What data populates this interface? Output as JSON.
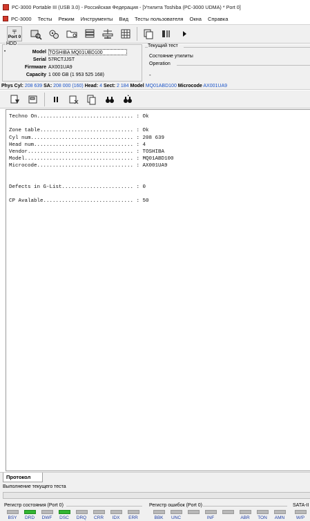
{
  "window": {
    "title": "PC-3000 Portable III (USB 3.0) - Российская Федерация - [Утилита Toshiba (PC-3000 UDMA) * Port 0]"
  },
  "menu": {
    "items": [
      "PC-3000",
      "Тесты",
      "Режим",
      "Инструменты",
      "Вид",
      "Тесты пользователя",
      "Окна",
      "Справка"
    ]
  },
  "toolbar1": {
    "port_label": "Port 0",
    "icons": [
      "port-icon",
      "drive-search-icon",
      "gears-icon",
      "folder-icon",
      "database-icon",
      "balance-icon",
      "grid-icon",
      "copy-icon",
      "log-icon",
      "play-icon"
    ]
  },
  "hdd": {
    "legend": "HDD",
    "rows": [
      {
        "key": "Model",
        "value": "TOSHIBA MQ01UBD100"
      },
      {
        "key": "Serial",
        "value": "57RCTJJST"
      },
      {
        "key": "Firmware",
        "value": "AX001UA9"
      },
      {
        "key": "Capacity",
        "value": "1 000 GB (1 953 525 168)"
      }
    ]
  },
  "current_test": {
    "legend": "Текущий тест",
    "value": "Состояние утилиты",
    "operation_legend": "Operation",
    "operation_value": "-"
  },
  "statusline": {
    "physcyl_label": "Phys Cyl:",
    "physcyl_value": "208 639",
    "sa_label": "SA:",
    "sa_value": "208 000 (160)",
    "head_label": "Head:",
    "head_value": "4",
    "sect_label": "Sect:",
    "sect_value": "2 184",
    "model_label": "Model",
    "model_value": "MQ01ABD100",
    "microcode_label": "Microcode",
    "microcode_value": "AX001UA9"
  },
  "log": {
    "lines": [
      "Techno On............................... : Ok",
      "",
      "Zone table.............................. : Ok",
      "Cyl num................................. : 208 639",
      "Head num................................ : 4",
      "Vendor.................................. : TOSHIBA",
      "Model................................... : MQ01ABD100",
      "Microcode............................... : AX001UA9",
      "",
      "",
      "Defects in G-List....................... : 0",
      "",
      "CP Avalable............................. : 50"
    ]
  },
  "tabs": {
    "active": "Протокол"
  },
  "progress": {
    "label": "Выполнение текущего теста"
  },
  "registers": {
    "status_title": "Регистр состояния (Port 0)",
    "error_title": "Регистр ошибок (Port 0)",
    "sata_title": "SATA-II",
    "status_leds": [
      {
        "label": "BSY",
        "on": false
      },
      {
        "label": "DRD",
        "on": true
      },
      {
        "label": "DWF",
        "on": false
      },
      {
        "label": "DSC",
        "on": true
      },
      {
        "label": "DRQ",
        "on": false
      },
      {
        "label": "CRR",
        "on": false
      },
      {
        "label": "IDX",
        "on": false
      },
      {
        "label": "ERR",
        "on": false
      }
    ],
    "error_leds": [
      {
        "label": "BBK",
        "on": false
      },
      {
        "label": "UNC",
        "on": false
      },
      {
        "label": "",
        "on": false
      },
      {
        "label": "INF",
        "on": false
      },
      {
        "label": "",
        "on": false
      },
      {
        "label": "ABR",
        "on": false
      },
      {
        "label": "TON",
        "on": false
      },
      {
        "label": "AMN",
        "on": false
      }
    ],
    "sata_leds": [
      {
        "label": "W/P",
        "on": false
      }
    ]
  }
}
